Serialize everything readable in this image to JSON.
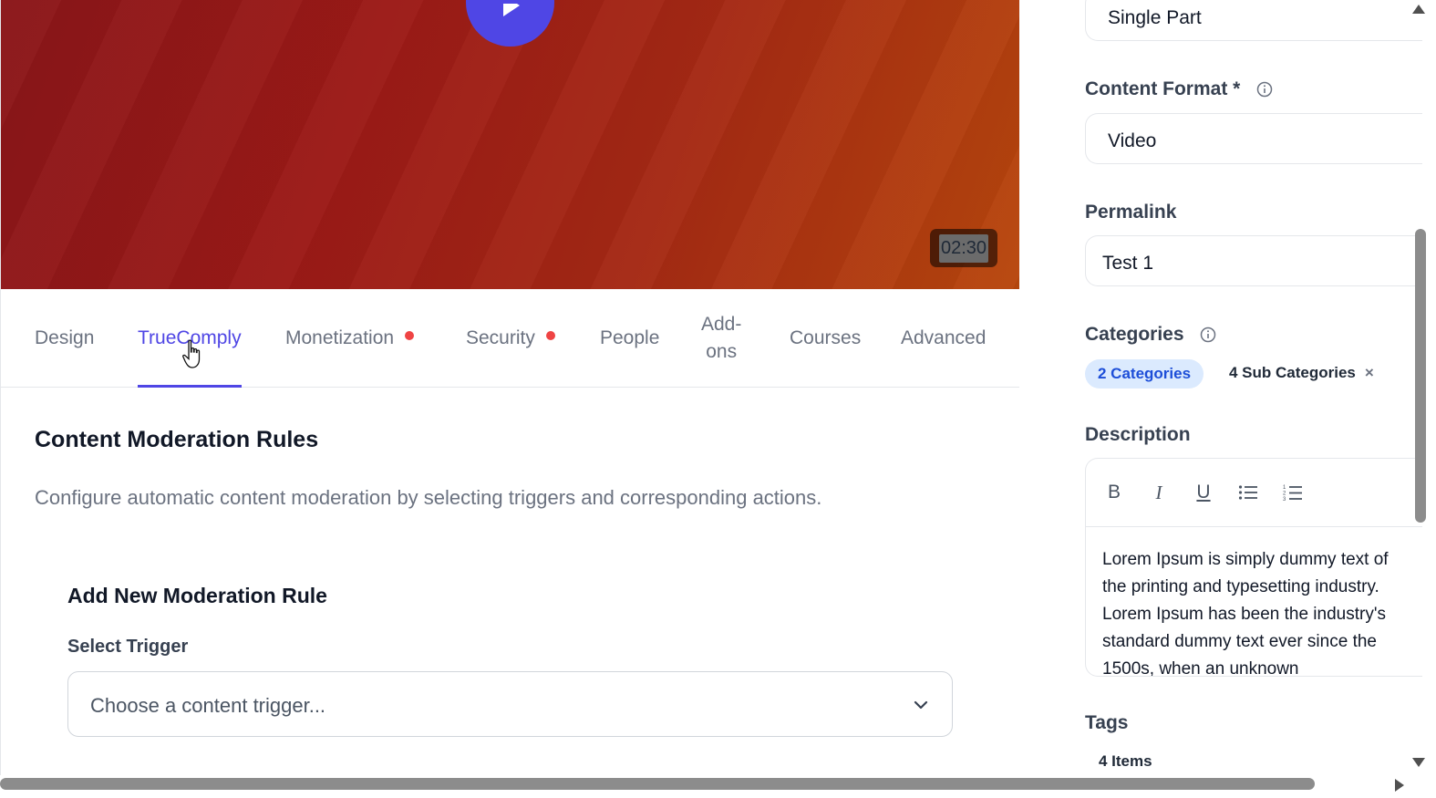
{
  "video": {
    "duration": "02:30"
  },
  "tabs": [
    {
      "label": "Design"
    },
    {
      "label": "TrueComply"
    },
    {
      "label": "Monetization"
    },
    {
      "label": "Security"
    },
    {
      "label": "People"
    },
    {
      "label": "Add-",
      "label2": "ons"
    },
    {
      "label": "Courses"
    },
    {
      "label": "Advanced"
    }
  ],
  "active_tab": "TrueComply",
  "content": {
    "title": "Content Moderation Rules",
    "description": "Configure automatic content moderation by selecting triggers and corresponding actions.",
    "rule_title": "Add New Moderation Rule",
    "trigger_label": "Select Trigger",
    "trigger_placeholder": "Choose a content trigger..."
  },
  "side": {
    "type_value": "Single Part",
    "content_format_label": "Content Format *",
    "content_format_value": "Video",
    "permalink_label": "Permalink",
    "permalink_value": "Test 1",
    "categories_label": "Categories",
    "categories_chip": "2 Categories",
    "sub_categories": "4 Sub Categories",
    "remove_symbol": "×",
    "description_label": "Description",
    "toolbar": [
      "B",
      "I",
      "U"
    ],
    "description_text": "Lorem Ipsum is simply dummy text of the printing and typesetting industry. Lorem Ipsum has been the industry's standard dummy text ever since the 1500s, when an unknown",
    "tags_label": "Tags",
    "tags_count": "4 Items"
  },
  "colors": {
    "accent": "#4f46e5",
    "alert_dot": "#ef4444",
    "chip_bg": "#dbeafe",
    "chip_text": "#1d4ed8"
  }
}
